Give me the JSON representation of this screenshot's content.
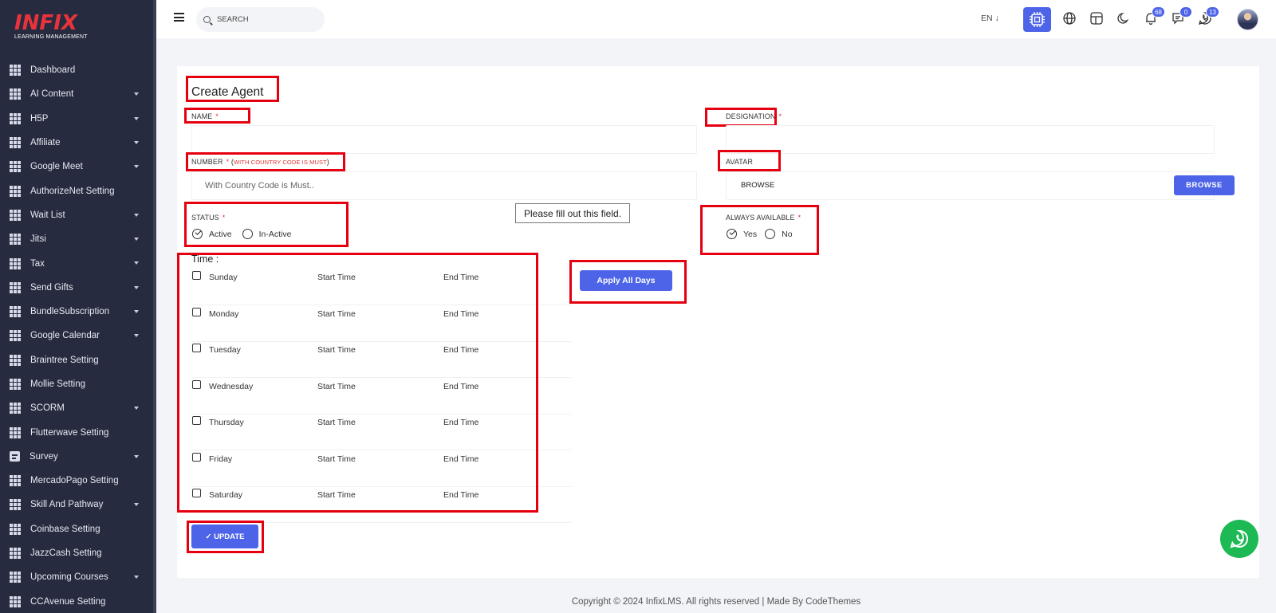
{
  "brand": {
    "logo_text": "INFIX",
    "logo_subtext": "LEARNING MANAGEMENT"
  },
  "sidebar": {
    "items": [
      {
        "label": "Dashboard",
        "icon": "grid-icon",
        "has_caret": false
      },
      {
        "label": "AI Content",
        "icon": "grid-icon",
        "has_caret": true
      },
      {
        "label": "H5P",
        "icon": "grid-icon",
        "has_caret": true
      },
      {
        "label": "Affiliate",
        "icon": "grid-icon",
        "has_caret": true
      },
      {
        "label": "Google Meet",
        "icon": "grid-icon",
        "has_caret": true
      },
      {
        "label": "AuthorizeNet Setting",
        "icon": "grid-icon",
        "has_caret": false
      },
      {
        "label": "Wait List",
        "icon": "grid-icon",
        "has_caret": true
      },
      {
        "label": "Jitsi",
        "icon": "grid-icon",
        "has_caret": true
      },
      {
        "label": "Tax",
        "icon": "grid-icon",
        "has_caret": true
      },
      {
        "label": "Send Gifts",
        "icon": "grid-icon",
        "has_caret": true
      },
      {
        "label": "BundleSubscription",
        "icon": "grid-icon",
        "has_caret": true
      },
      {
        "label": "Google Calendar",
        "icon": "grid-icon",
        "has_caret": true
      },
      {
        "label": "Braintree Setting",
        "icon": "grid-icon",
        "has_caret": false
      },
      {
        "label": "Mollie Setting",
        "icon": "grid-icon",
        "has_caret": false
      },
      {
        "label": "SCORM",
        "icon": "grid-icon",
        "has_caret": true
      },
      {
        "label": "Flutterwave Setting",
        "icon": "grid-icon",
        "has_caret": false
      },
      {
        "label": "Survey",
        "icon": "document-icon",
        "has_caret": true
      },
      {
        "label": "MercadoPago Setting",
        "icon": "grid-icon",
        "has_caret": false
      },
      {
        "label": "Skill And Pathway",
        "icon": "grid-icon",
        "has_caret": true
      },
      {
        "label": "Coinbase Setting",
        "icon": "grid-icon",
        "has_caret": false
      },
      {
        "label": "JazzCash Setting",
        "icon": "grid-icon",
        "has_caret": false
      },
      {
        "label": "Upcoming Courses",
        "icon": "grid-icon",
        "has_caret": true
      },
      {
        "label": "CCAvenue Setting",
        "icon": "grid-icon",
        "has_caret": false
      }
    ]
  },
  "header": {
    "search_placeholder": "SEARCH",
    "language": "EN",
    "notifications_count": "68",
    "messages_count": "0",
    "whatsapp_count": "13",
    "accent_color": "#4d64e8"
  },
  "form": {
    "title": "Create Agent",
    "name_label": "NAME",
    "designation_label": "DESIGNATION",
    "number_label": "NUMBER",
    "number_hint_open": "(",
    "number_hint": "WITH COUNTRY CODE IS MUST",
    "number_hint_close": ")",
    "number_placeholder": "With Country Code is Must..",
    "avatar_label": "AVATAR",
    "avatar_placeholder": "BROWSE",
    "browse_button": "BROWSE",
    "required_mark": "*",
    "tooltip": "Please fill out this field.",
    "status_label": "STATUS",
    "status_options": [
      "Active",
      "In-Active"
    ],
    "always_available_label": "ALWAYS AVAILABLE",
    "always_available_options": [
      "Yes",
      "No"
    ],
    "time_label": "Time :",
    "apply_all_days": "Apply All Days",
    "days": [
      {
        "name": "Sunday",
        "start": "Start Time",
        "end": "End Time"
      },
      {
        "name": "Monday",
        "start": "Start Time",
        "end": "End Time"
      },
      {
        "name": "Tuesday",
        "start": "Start Time",
        "end": "End Time"
      },
      {
        "name": "Wednesday",
        "start": "Start Time",
        "end": "End Time"
      },
      {
        "name": "Thursday",
        "start": "Start Time",
        "end": "End Time"
      },
      {
        "name": "Friday",
        "start": "Start Time",
        "end": "End Time"
      },
      {
        "name": "Saturday",
        "start": "Start Time",
        "end": "End Time"
      }
    ],
    "update_button": "✓ UPDATE"
  },
  "footer": {
    "text": "Copyright © 2024 InfixLMS. All rights reserved | Made By CodeThemes"
  }
}
